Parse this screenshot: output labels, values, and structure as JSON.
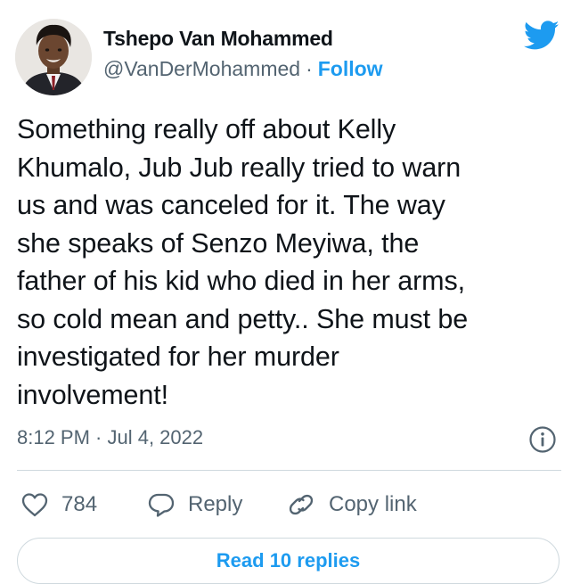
{
  "author": {
    "display_name": "Tshepo Van Mohammed",
    "handle": "@VanDerMohammed",
    "separator": "·",
    "follow_label": "Follow"
  },
  "tweet": {
    "text": "Something really off about Kelly\nKhumalo, Jub Jub really tried to warn\nus and was canceled for it. The way\nshe speaks of Senzo Meyiwa, the\nfather of his kid who died in her arms,\nso cold mean and petty.. She must be\ninvestigated for her murder\ninvolvement!",
    "timestamp": "8:12 PM · Jul 4, 2022"
  },
  "actions": {
    "like_count": "784",
    "reply_label": "Reply",
    "copy_link_label": "Copy link"
  },
  "footer": {
    "read_replies_label": "Read 10 replies"
  },
  "icons": {
    "brand": "twitter-bird-icon",
    "info": "info-icon",
    "like": "heart-icon",
    "reply": "speech-bubble-icon",
    "copy": "link-icon"
  },
  "colors": {
    "accent": "#1d9bf0",
    "text": "#0f1419",
    "secondary": "#536471",
    "border": "#cfd9de"
  }
}
